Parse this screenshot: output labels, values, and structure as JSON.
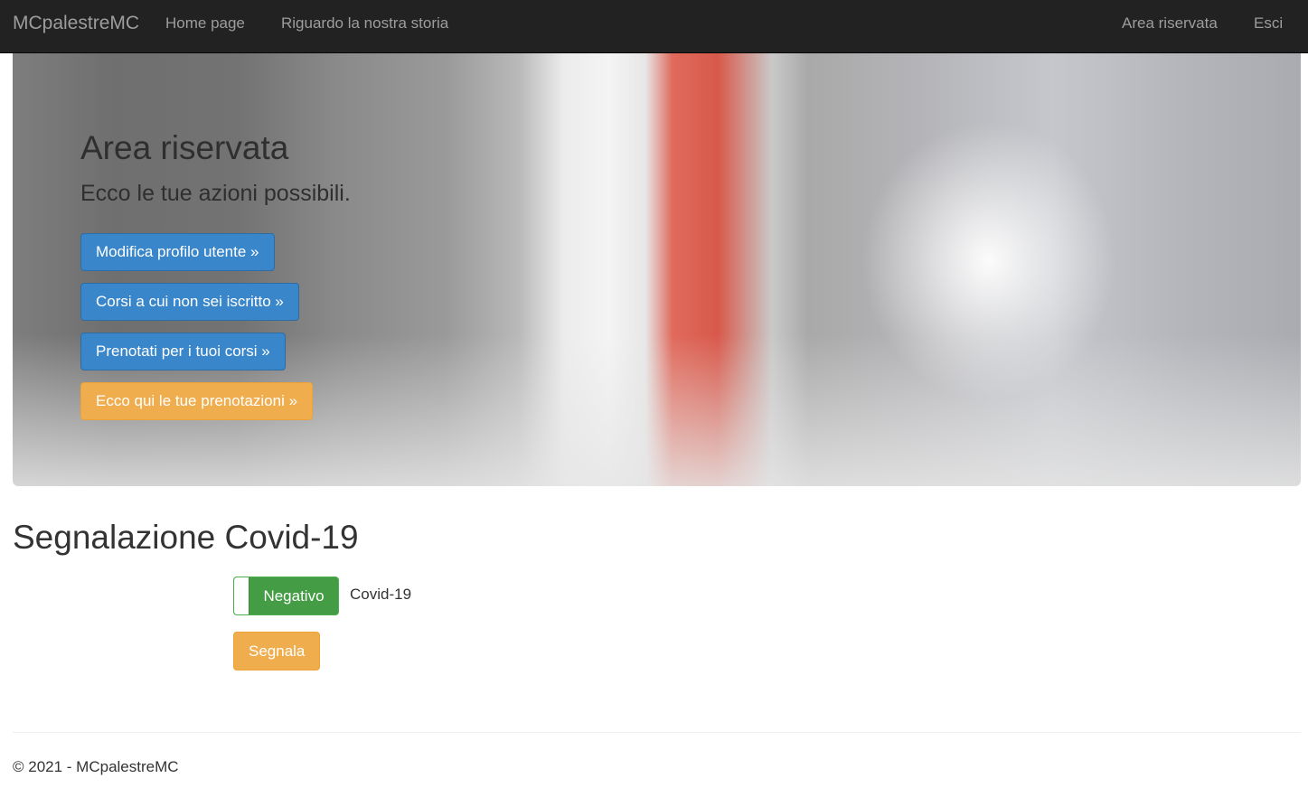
{
  "navbar": {
    "brand": "MCpalestreMC",
    "links": [
      {
        "label": "Home page"
      },
      {
        "label": "Riguardo la nostra storia"
      }
    ],
    "right_links": [
      {
        "label": "Area riservata"
      },
      {
        "label": "Esci"
      }
    ]
  },
  "hero": {
    "title": "Area riservata",
    "subtitle": "Ecco le tue azioni possibili.",
    "buttons": [
      {
        "label": "Modifica profilo utente »",
        "style": "primary"
      },
      {
        "label": "Corsi a cui non sei iscritto »",
        "style": "primary"
      },
      {
        "label": "Prenotati per i tuoi corsi »",
        "style": "primary"
      },
      {
        "label": "Ecco qui le tue prenotazioni »",
        "style": "warning"
      }
    ]
  },
  "covid": {
    "title": "Segnalazione Covid-19",
    "toggle_state": "Negativo",
    "toggle_label": "Covid-19",
    "submit_label": "Segnala"
  },
  "footer": {
    "text": "© 2021 - MCpalestreMC"
  },
  "colors": {
    "navbar_bg": "#222222",
    "primary": "#3a86ca",
    "warning": "#f0ad4e",
    "success": "#449d44"
  }
}
